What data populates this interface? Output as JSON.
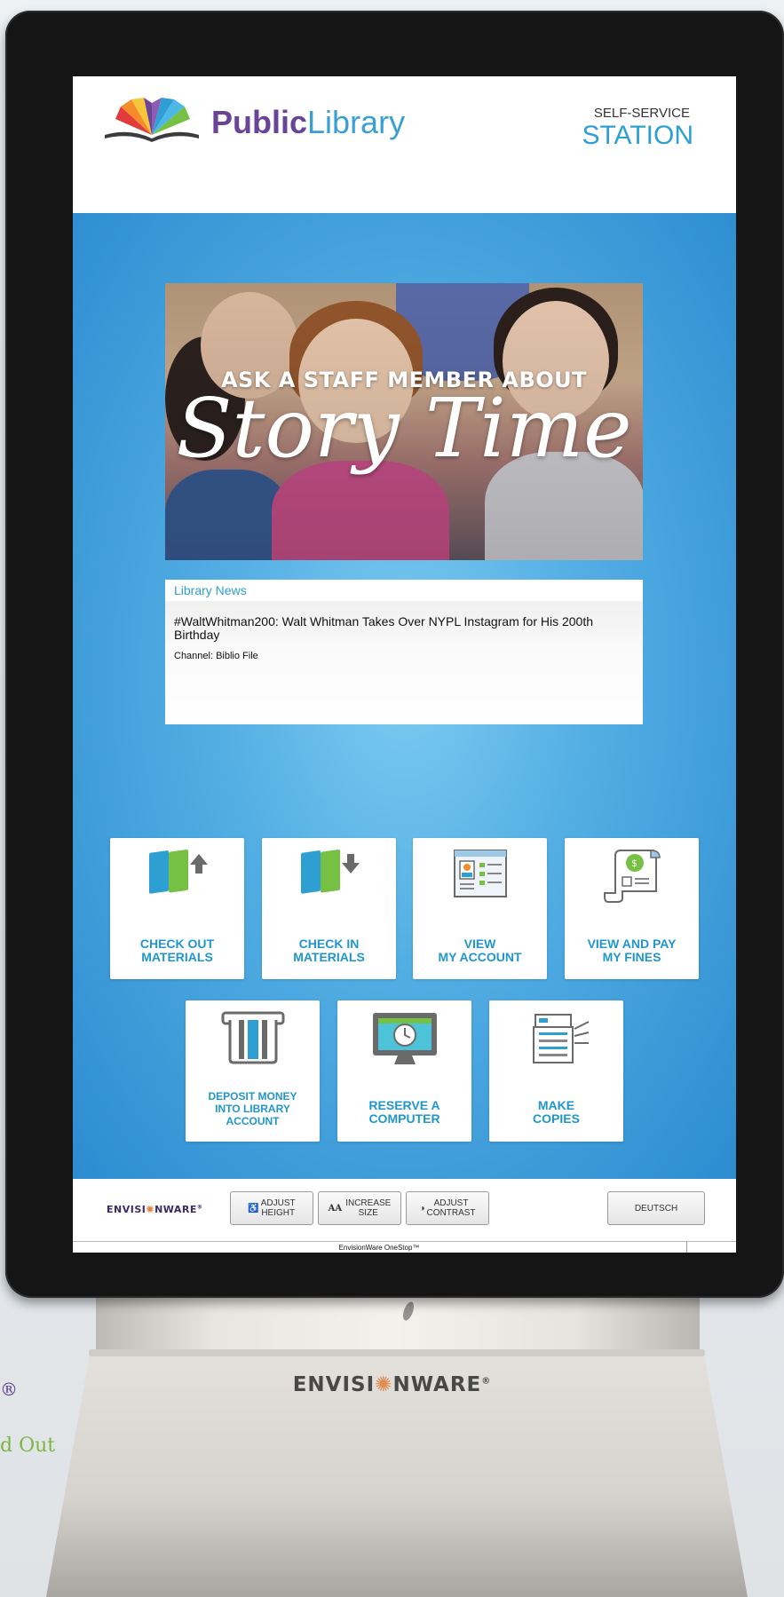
{
  "background": {
    "registered_mark": "®",
    "tagline_fragment": "d Out"
  },
  "header": {
    "brand_bold": "Public",
    "brand_light": "Library",
    "station_small": "SELF-SERVICE",
    "station_big": "STATION"
  },
  "banner": {
    "line1": "ASK A STAFF MEMBER ABOUT",
    "line2": "Story Time"
  },
  "news": {
    "title": "Library News",
    "headline": "#WaltWhitman200: Walt Whitman Takes Over NYPL Instagram for His 200th Birthday",
    "channel": "Channel:  Biblio File"
  },
  "tiles": [
    {
      "label": "CHECK OUT\nMATERIALS",
      "icon": "checkout-books-icon"
    },
    {
      "label": "CHECK IN\nMATERIALS",
      "icon": "checkin-books-icon"
    },
    {
      "label": "VIEW\nMY ACCOUNT",
      "icon": "account-icon"
    },
    {
      "label": "VIEW AND PAY\nMY FINES",
      "icon": "fines-receipt-icon"
    },
    {
      "label": "DEPOSIT MONEY\nINTO LIBRARY\nACCOUNT",
      "icon": "card-slot-icon"
    },
    {
      "label": "RESERVE A\nCOMPUTER",
      "icon": "computer-clock-icon"
    },
    {
      "label": "MAKE\nCOPIES",
      "icon": "copier-icon"
    }
  ],
  "footer": {
    "brand_left": "ENVISI",
    "brand_right": "NWARE",
    "registered": "®",
    "adjust_height": "ADJUST\nHEIGHT",
    "increase_size": "INCREASE\nSIZE",
    "increase_size_glyph": "AA",
    "adjust_contrast": "ADJUST\nCONTRAST",
    "language": "DEUTSCH"
  },
  "status_bar": {
    "text": "EnvisionWare OneStop™"
  },
  "stand": {
    "brand_left": "ENVISI",
    "brand_right": "NWARE",
    "registered": "®"
  },
  "colors": {
    "accent_blue": "#2e9fd3",
    "brand_purple": "#6a4496",
    "tile_text": "#2196cc",
    "book_green": "#76c043",
    "book_blue": "#2d9fd3"
  }
}
